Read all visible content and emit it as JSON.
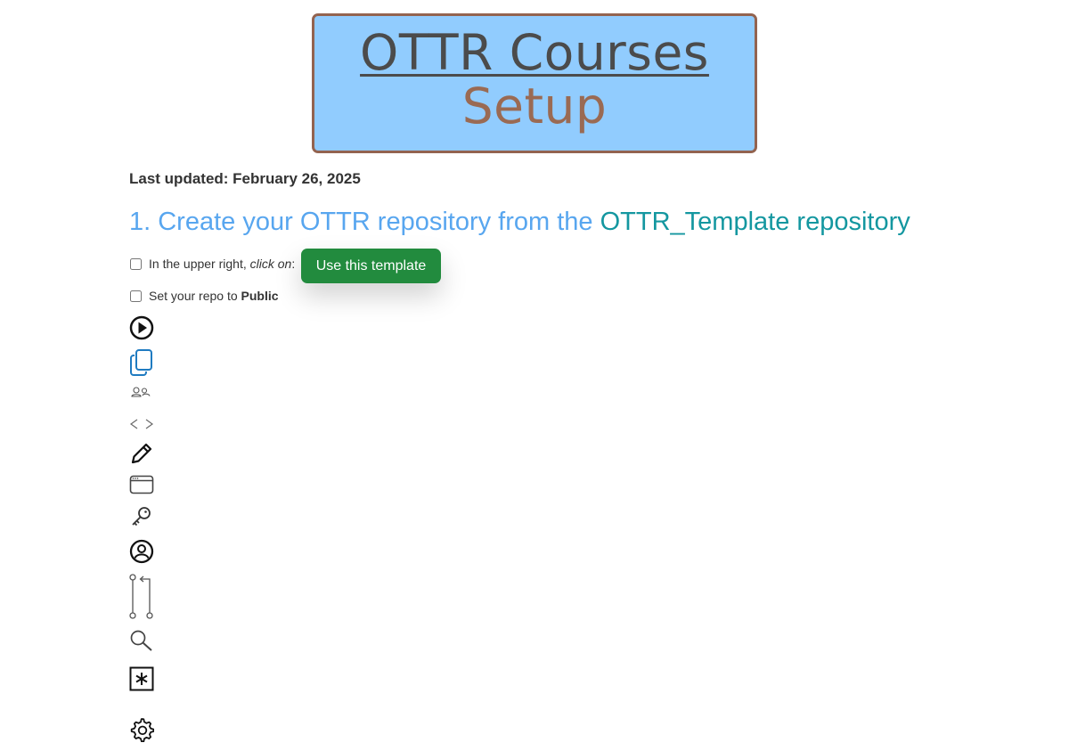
{
  "banner": {
    "title": "OTTR Courses",
    "subtitle": "Setup",
    "background_color": "#91ccfe",
    "border_color": "#93634f"
  },
  "last_updated": "Last updated: February 26, 2025",
  "section": {
    "number_text": "1. Create your OTTR repository from the ",
    "link_text": "OTTR_Template repository",
    "heading_color": "#58a6ef",
    "link_color": "#1497a0"
  },
  "tasks": [
    {
      "prefix": "In the upper right, ",
      "emphasis": "click on",
      "suffix": ":",
      "checked": false
    },
    {
      "prefix": "Set your repo to ",
      "strong": "Public",
      "checked": false
    }
  ],
  "use_template_button": {
    "label": "Use this template",
    "color": "#228b3e"
  },
  "icons": [
    "play-circle-icon",
    "copy-icon",
    "people-icon",
    "code-icon",
    "pencil-icon",
    "browser-window-icon",
    "key-icon",
    "person-circle-icon",
    "pull-request-icon",
    "search-icon",
    "asterisk-box-icon",
    "gear-icon"
  ]
}
